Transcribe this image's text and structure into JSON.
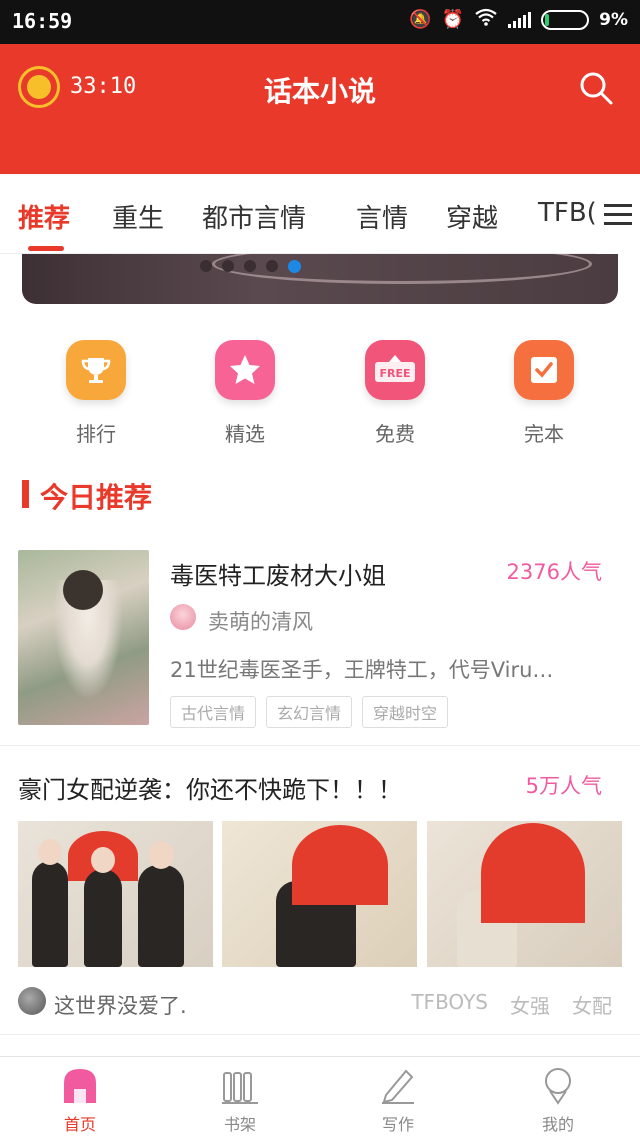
{
  "status_bar": {
    "time": "16:59",
    "battery_pct": "9%",
    "battery_level": 0.09
  },
  "header": {
    "timer": "33:10",
    "title": "话本小说"
  },
  "tabs": [
    {
      "label": "推荐",
      "active": true
    },
    {
      "label": "重生"
    },
    {
      "label": "都市言情"
    },
    {
      "label": "言情"
    },
    {
      "label": "穿越"
    },
    {
      "label": "TFB("
    }
  ],
  "quick_entries": [
    {
      "label": "排行",
      "icon": "trophy-icon",
      "color": "#f8a83a"
    },
    {
      "label": "精选",
      "icon": "star-icon",
      "color": "#f66394"
    },
    {
      "label": "免费",
      "icon": "free-icon",
      "color": "#f1567a",
      "badge": "FREE"
    },
    {
      "label": "完本",
      "icon": "check-icon",
      "color": "#f6703f"
    }
  ],
  "section": {
    "title": "今日推荐"
  },
  "book1": {
    "title": "毒医特工废材大小姐",
    "popularity": "2376人气",
    "author": "卖萌的清风",
    "description": "21世纪毒医圣手，王牌特工，代号Viru…",
    "tags": [
      "古代言情",
      "玄幻言情",
      "穿越时空"
    ]
  },
  "book2": {
    "title": "豪门女配逆袭：你还不快跪下！！！",
    "popularity": "5万人气",
    "author": "这世界没爱了.",
    "tags": [
      "TFBOYS",
      "女强",
      "女配"
    ]
  },
  "bottom_nav": [
    {
      "label": "首页",
      "icon": "home-icon",
      "active": true
    },
    {
      "label": "书架",
      "icon": "bookshelf-icon"
    },
    {
      "label": "写作",
      "icon": "pen-icon"
    },
    {
      "label": "我的",
      "icon": "profile-icon"
    }
  ],
  "colors": {
    "primary": "#e8392a",
    "popularity": "#f25aa0",
    "coin": "#f7c02b",
    "active_dot": "#1e88e5"
  }
}
